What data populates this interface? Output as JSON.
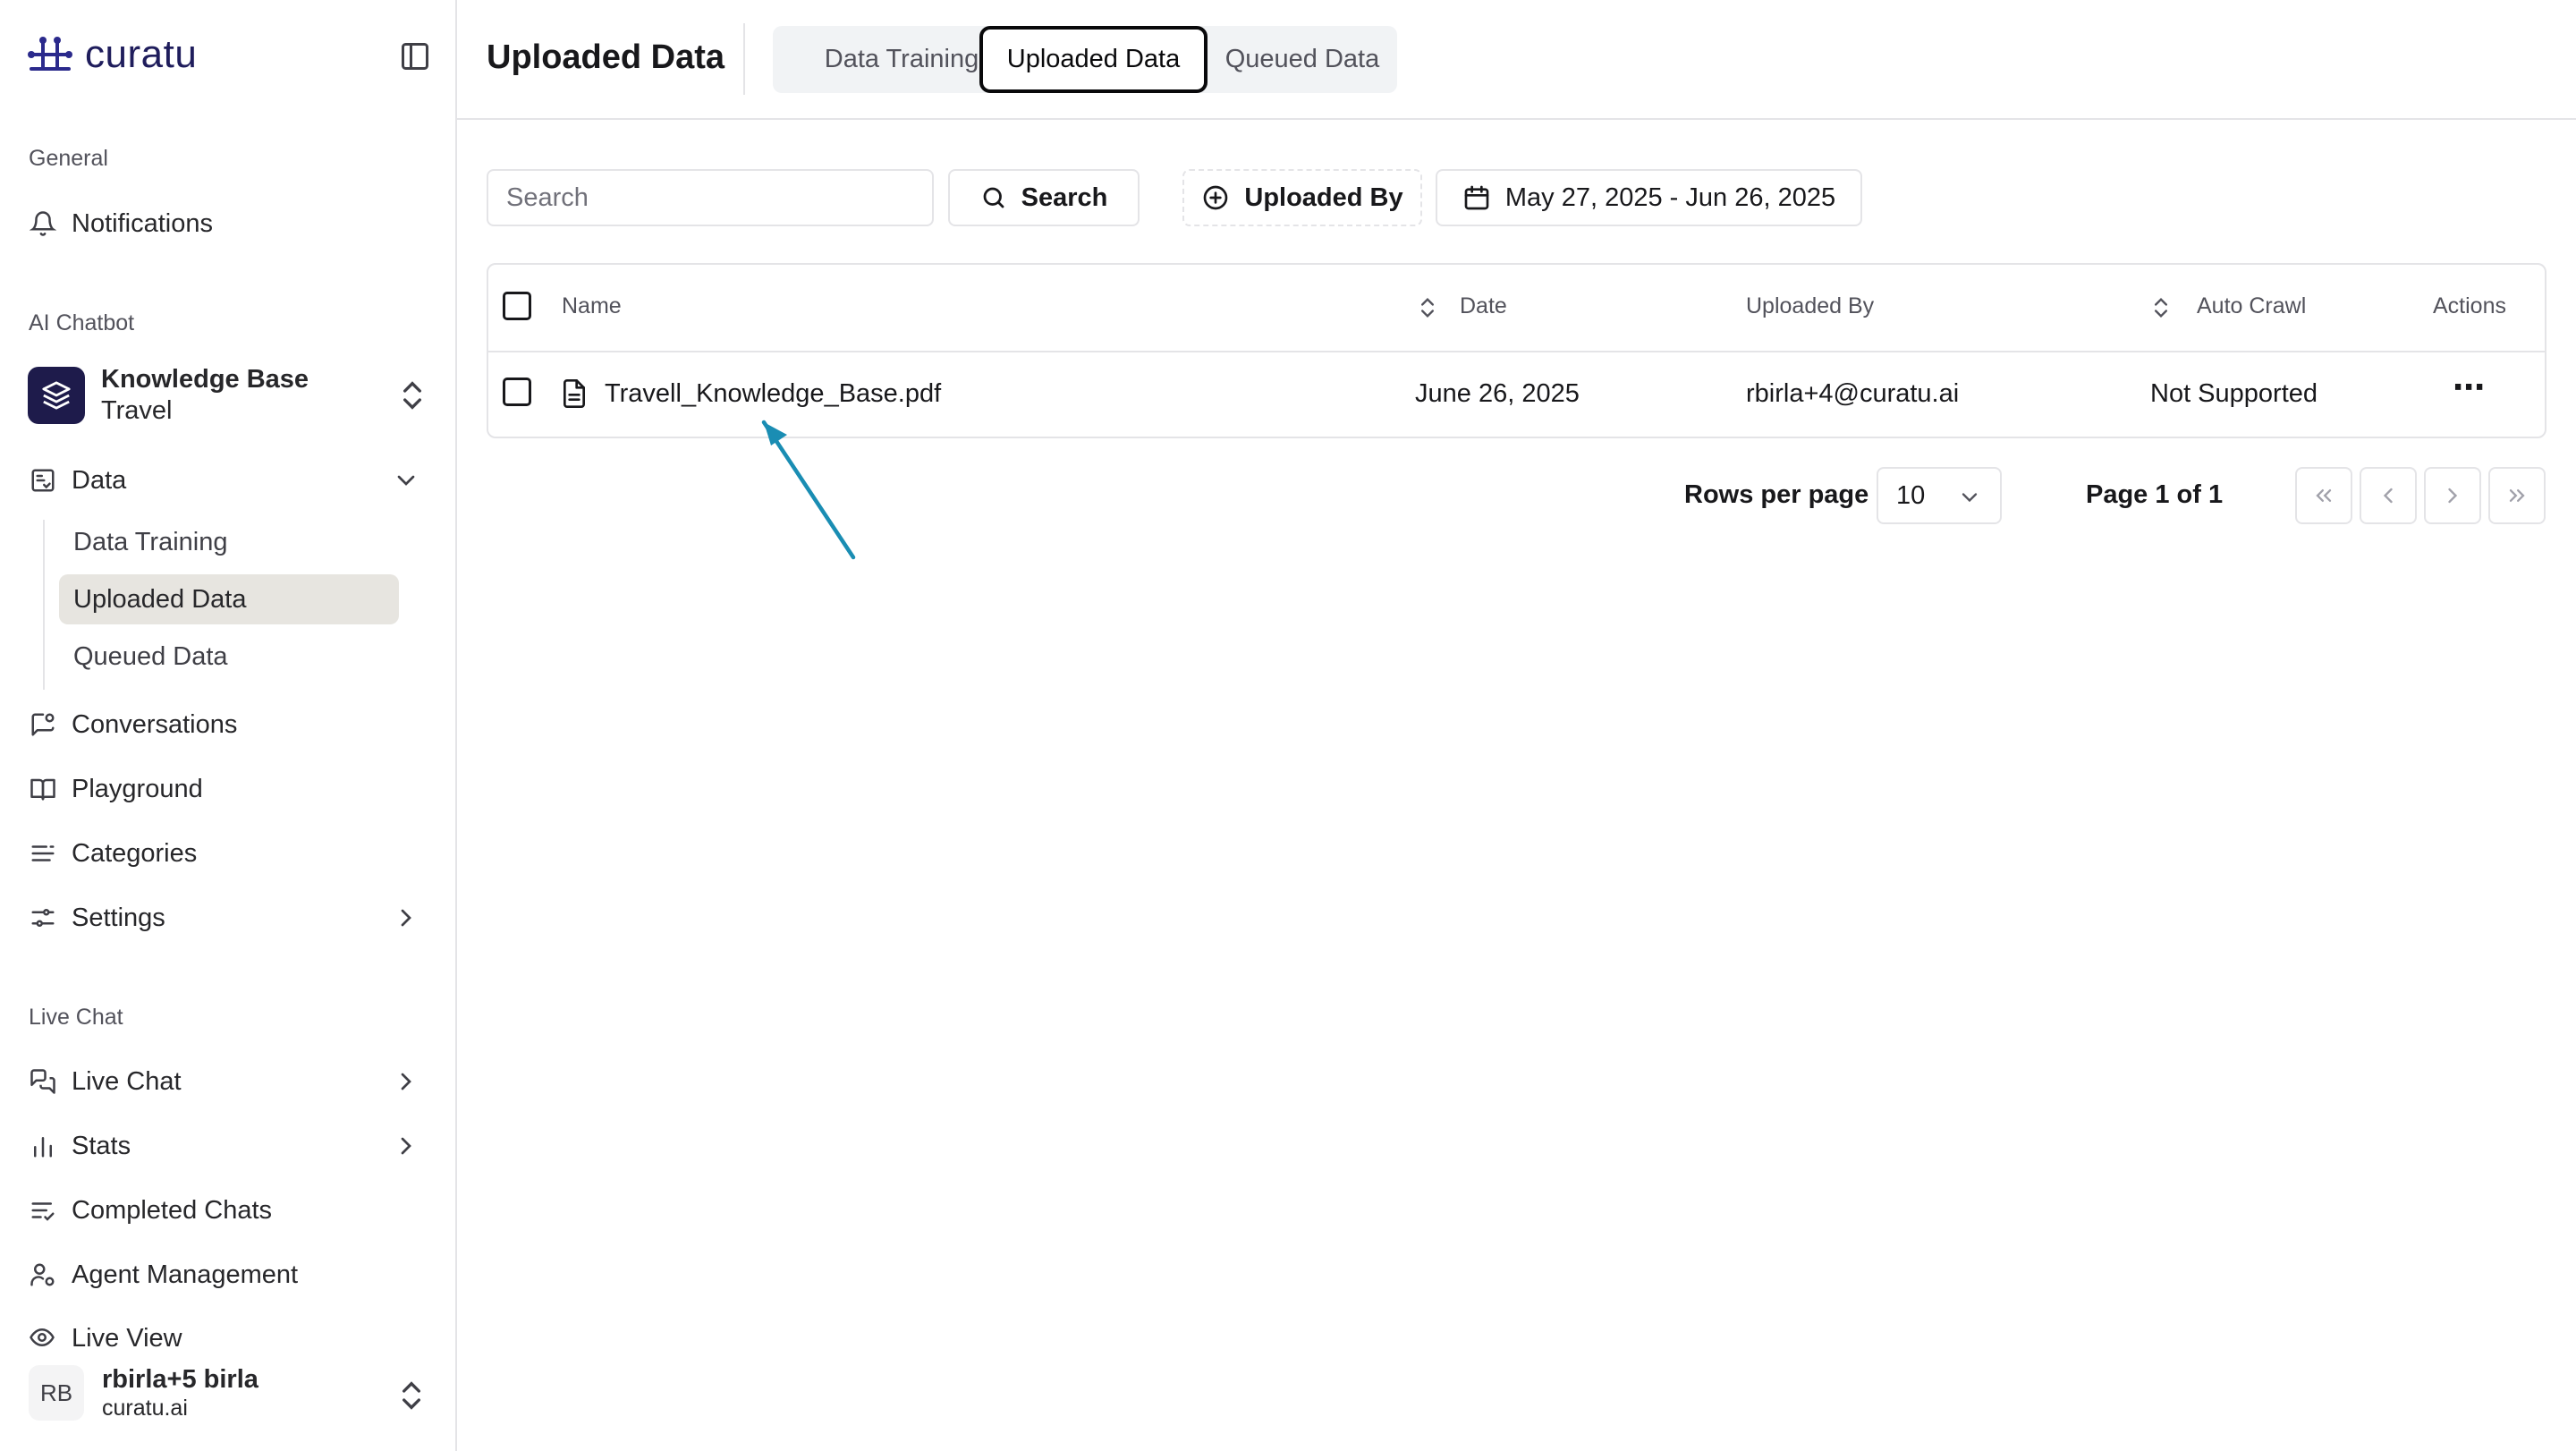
{
  "sidebar": {
    "logo_text": "curatu",
    "sections": {
      "general": "General",
      "ai_chatbot": "AI Chatbot",
      "live_chat": "Live Chat"
    },
    "notifications": "Notifications",
    "knowledge_base": {
      "title": "Knowledge Base",
      "subtitle": "Travel"
    },
    "data": "Data",
    "data_subitems": [
      "Data Training",
      "Uploaded Data",
      "Queued Data"
    ],
    "conversations": "Conversations",
    "playground": "Playground",
    "categories": "Categories",
    "settings": "Settings",
    "live_chat_item": "Live Chat",
    "stats": "Stats",
    "completed_chats": "Completed Chats",
    "agent_management": "Agent Management",
    "live_view_partial": "Live View",
    "user": {
      "initials": "RB",
      "name": "rbirla+5 birla",
      "org": "curatu.ai"
    }
  },
  "header": {
    "title": "Uploaded Data",
    "tabs": [
      {
        "label": "Data Training",
        "active": false
      },
      {
        "label": "Uploaded Data",
        "active": true
      },
      {
        "label": "Queued Data",
        "active": false
      }
    ]
  },
  "toolbar": {
    "search_placeholder": "Search",
    "search_button": "Search",
    "uploaded_by_filter": "Uploaded By",
    "date_range": "May 27, 2025 - Jun 26, 2025"
  },
  "table": {
    "headers": {
      "name": "Name",
      "date": "Date",
      "uploaded_by": "Uploaded By",
      "auto_crawl": "Auto Crawl",
      "actions": "Actions"
    },
    "rows": [
      {
        "name": "Travell_Knowledge_Base.pdf",
        "date": "June 26, 2025",
        "uploaded_by": "rbirla+4@curatu.ai",
        "auto_crawl": "Not Supported",
        "actions": "⋯"
      }
    ]
  },
  "pagination": {
    "rows_per_page_label": "Rows per page",
    "rows_per_page_value": "10",
    "page_text": "Page 1 of 1"
  },
  "colors": {
    "brand": "#1e1b4b",
    "annotation_arrow": "#1a8db3",
    "active_nav_bg": "#e7e5e0"
  }
}
